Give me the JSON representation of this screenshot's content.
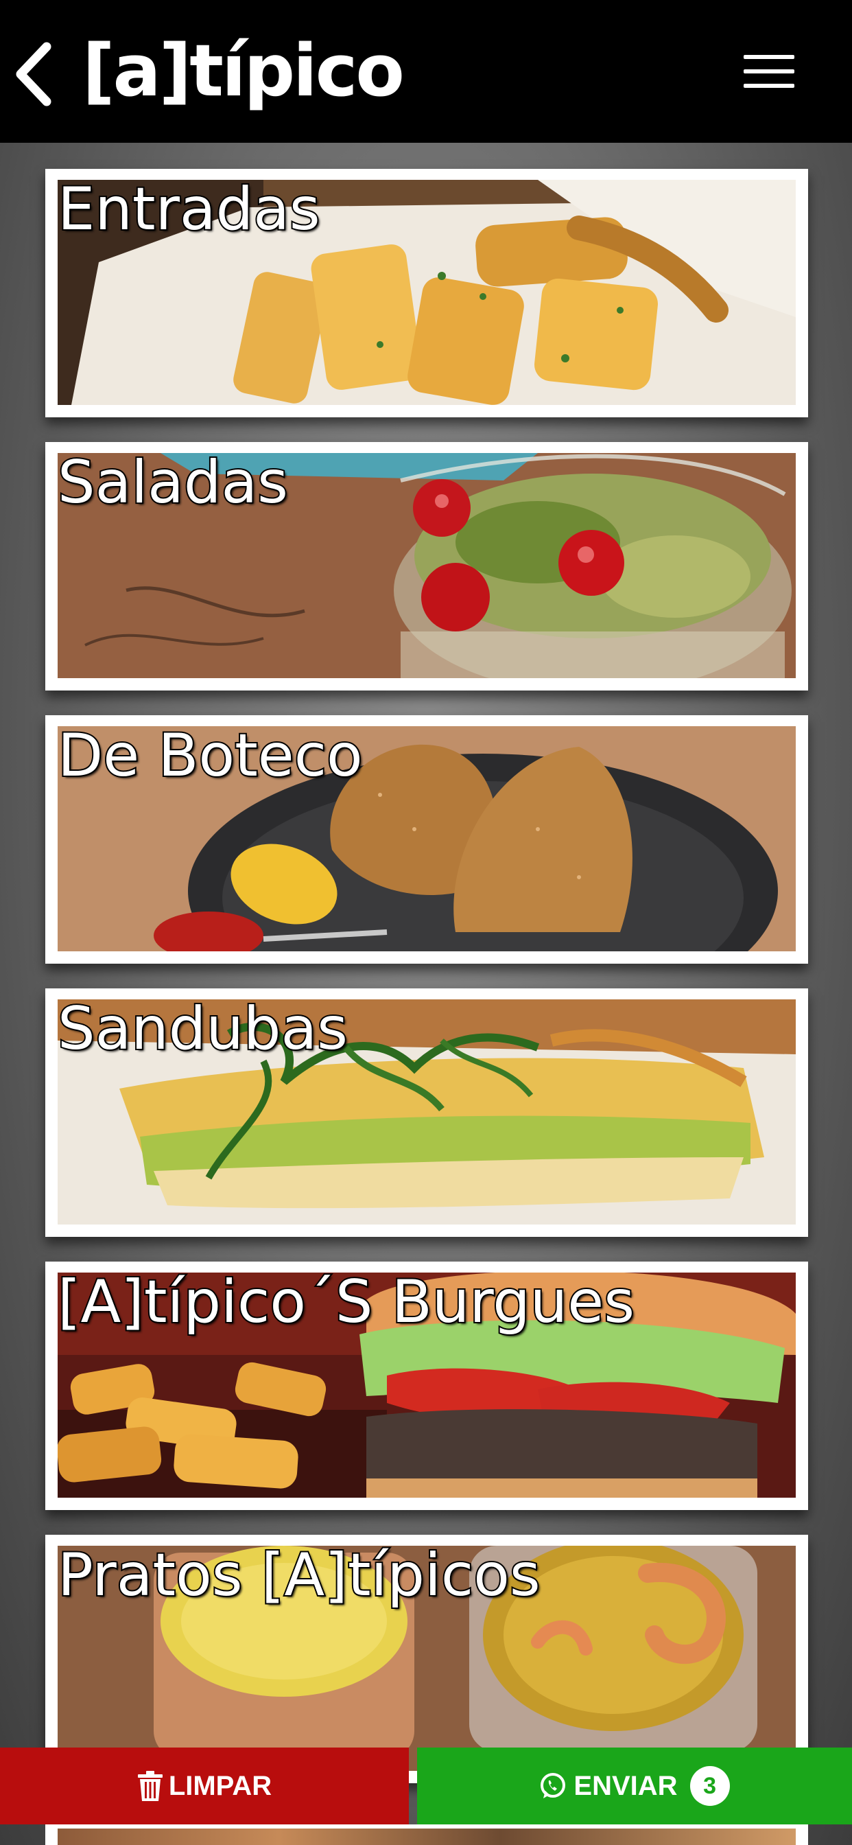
{
  "header": {
    "logo_text": "[a]típico",
    "back_icon": "chevron-left-icon",
    "menu_icon": "hamburger-menu-icon"
  },
  "categories": [
    {
      "label": "Entradas",
      "image": "fried-cassava-photo"
    },
    {
      "label": "Saladas",
      "image": "salad-jar-photo"
    },
    {
      "label": "De Boteco",
      "image": "coxinha-photo"
    },
    {
      "label": "Sandubas",
      "image": "sandwich-photo"
    },
    {
      "label": "[A]típico´S Burgues",
      "image": "burger-fries-photo"
    },
    {
      "label": "Pratos [A]típicos",
      "image": "rice-and-stew-photo"
    }
  ],
  "actions": {
    "clear_label": "LIMPAR",
    "clear_icon": "trash-icon",
    "send_label": "ENVIAR",
    "send_icon": "whatsapp-icon",
    "cart_count": "3"
  },
  "colors": {
    "header_bg": "#000000",
    "clear_button": "#b80d0d",
    "send_button": "#1aa61a"
  }
}
